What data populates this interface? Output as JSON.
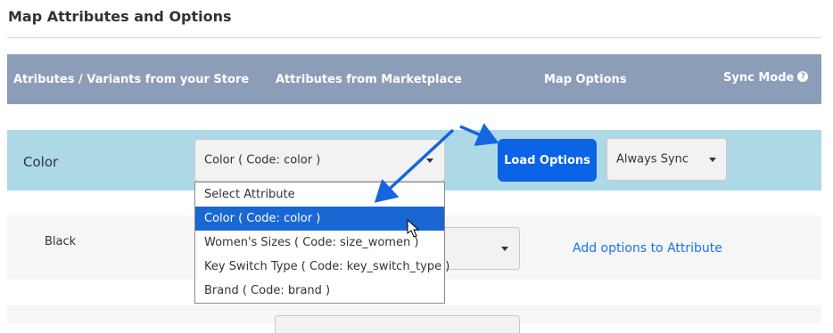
{
  "section": {
    "title": "Map Attributes and Options"
  },
  "table_header": {
    "col1": "Atributes / Variants from your Store",
    "col2": "Attributes from Marketplace",
    "col3": "Map Options",
    "col4": "Sync Mode",
    "help_icon": "?"
  },
  "color_row": {
    "label": "Color",
    "attribute_select_value": "Color ( Code: color )",
    "load_button": "Load Options",
    "sync_select_value": "Always Sync"
  },
  "dropdown_options": [
    "Select Attribute",
    "Color ( Code: color )",
    "Women's Sizes ( Code: size_women )",
    "Key Switch Type ( Code: key_switch_type )",
    "Brand ( Code: brand )"
  ],
  "black_row": {
    "label": "Black",
    "link": "Add options to Attribute"
  },
  "colors": {
    "header_bg": "#8c9db8",
    "row_highlight": "#add8e6",
    "accent": "#0b63e5",
    "arrow": "#1565e0"
  }
}
